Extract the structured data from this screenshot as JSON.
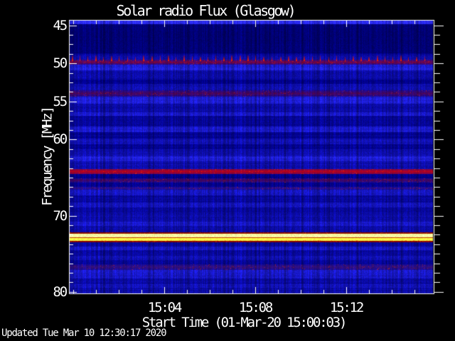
{
  "page": {
    "background": "#000000",
    "text_color": "#ffffff",
    "axis_color": "#ffffff"
  },
  "chart_data": {
    "type": "heatmap",
    "title": "Solar radio Flux (Glasgow)",
    "xlabel": "Start Time (01-Mar-20 15:00:03)",
    "ylabel": "Frequency [MHz]",
    "y_axis_direction": "inverted (45 MHz at top, 80 MHz at bottom)",
    "y_range_mhz": [
      44.3,
      80.2
    ],
    "x_ticks": [
      {
        "label": "15:04",
        "minute": 4
      },
      {
        "label": "15:08",
        "minute": 8
      },
      {
        "label": "15:12",
        "minute": 12
      }
    ],
    "x_minor_tick_minutes": [
      0,
      1,
      2,
      3,
      5,
      6,
      7,
      9,
      10,
      11,
      13,
      14,
      15
    ],
    "y_ticks": [
      {
        "label": "45",
        "mhz": 45
      },
      {
        "label": "50",
        "mhz": 50
      },
      {
        "label": "55",
        "mhz": 55
      },
      {
        "label": "60",
        "mhz": 60
      },
      {
        "label": "70",
        "mhz": 70
      },
      {
        "label": "80",
        "mhz": 80
      }
    ],
    "y_minor_tick_mhz": [
      46.25,
      47.5,
      48.75,
      51.25,
      52.5,
      53.75,
      56.25,
      57.5,
      58.75,
      61.25,
      62.5,
      63.75,
      65,
      66.25,
      67.5,
      68.75,
      71.25,
      72.5,
      73.75,
      75,
      76.25,
      77.5,
      78.75
    ],
    "palette": {
      "background_blue": "#0a0ac0",
      "bright_blue": "#2525f0",
      "dark_blue": "#000070",
      "band_red": "#d80000",
      "band_dark_red": "#96000a",
      "band_maroon": "#6e1440",
      "band_purple": "#78155f",
      "band_yellow": "#ffff55",
      "comb_red": "#d21400",
      "axis": "#ffffff"
    },
    "rfi_bands": [
      {
        "kind": "comb",
        "f_start": 48.95,
        "f_end": 49.62,
        "color": "#d21400",
        "spacing_px": 11,
        "note": "periodic spike comb above 50 MHz line"
      },
      {
        "kind": "mottled",
        "f_start": 49.55,
        "f_end": 50.2,
        "color": "#c00000",
        "intensity": 0.8
      },
      {
        "kind": "mottled",
        "f_start": 53.55,
        "f_end": 54.35,
        "color": "#96000a",
        "intensity": 0.6
      },
      {
        "kind": "solid",
        "f_start": 63.88,
        "f_end": 64.55,
        "color": "#d80000",
        "intensity": 0.92
      },
      {
        "kind": "mottled",
        "f_start": 65.1,
        "f_end": 65.68,
        "color": "#8c000f",
        "intensity": 0.62
      },
      {
        "kind": "mottled",
        "f_start": 66.2,
        "f_end": 66.62,
        "color": "#78155f",
        "intensity": 0.5
      },
      {
        "kind": "saturated",
        "f_start": 72.18,
        "f_end": 73.5,
        "colors": [
          "#8c0f00",
          "#ffffa0",
          "#c83c00",
          "#ffff48",
          "#8c0a00"
        ],
        "intensity": 1.0,
        "note": "strong saturated emission line"
      },
      {
        "kind": "mottled",
        "f_start": 76.38,
        "f_end": 77.15,
        "color": "#6e1440",
        "intensity": 0.55
      }
    ],
    "row_profile": [
      [
        44.3,
        44.9,
        1.0
      ],
      [
        44.9,
        48.7,
        0.3
      ],
      [
        48.7,
        48.9,
        0.45
      ],
      [
        50.2,
        50.9,
        0.8
      ],
      [
        50.9,
        52.1,
        0.55
      ],
      [
        52.1,
        52.7,
        0.42
      ],
      [
        52.7,
        53.55,
        0.58
      ],
      [
        54.35,
        55.3,
        0.78
      ],
      [
        55.3,
        56.4,
        0.55
      ],
      [
        56.4,
        56.9,
        0.75
      ],
      [
        56.9,
        58.3,
        0.48
      ],
      [
        58.3,
        59.0,
        0.72
      ],
      [
        59.0,
        59.9,
        0.45
      ],
      [
        59.9,
        60.6,
        0.62
      ],
      [
        60.6,
        61.3,
        0.45
      ],
      [
        61.3,
        62.2,
        0.58
      ],
      [
        62.2,
        62.9,
        0.8
      ],
      [
        62.9,
        63.88,
        0.58
      ],
      [
        64.55,
        65.1,
        0.42
      ],
      [
        65.68,
        66.2,
        0.45
      ],
      [
        66.62,
        67.3,
        0.68
      ],
      [
        67.3,
        68.3,
        0.5
      ],
      [
        68.3,
        68.9,
        0.66
      ],
      [
        68.9,
        69.6,
        0.48
      ],
      [
        69.6,
        70.8,
        0.55
      ],
      [
        70.8,
        71.3,
        0.72
      ],
      [
        71.3,
        72.18,
        0.55
      ],
      [
        73.5,
        74.0,
        0.5
      ],
      [
        74.0,
        74.5,
        0.7
      ],
      [
        74.5,
        75.3,
        0.5
      ],
      [
        75.3,
        75.8,
        0.62
      ],
      [
        75.8,
        76.38,
        0.48
      ],
      [
        77.15,
        78.2,
        0.72
      ],
      [
        78.2,
        79.0,
        0.52
      ],
      [
        79.0,
        79.5,
        0.65
      ],
      [
        79.5,
        80.3,
        0.55
      ]
    ]
  },
  "footer": {
    "updated": "Updated Tue Mar 10 12:30:17 2020"
  }
}
